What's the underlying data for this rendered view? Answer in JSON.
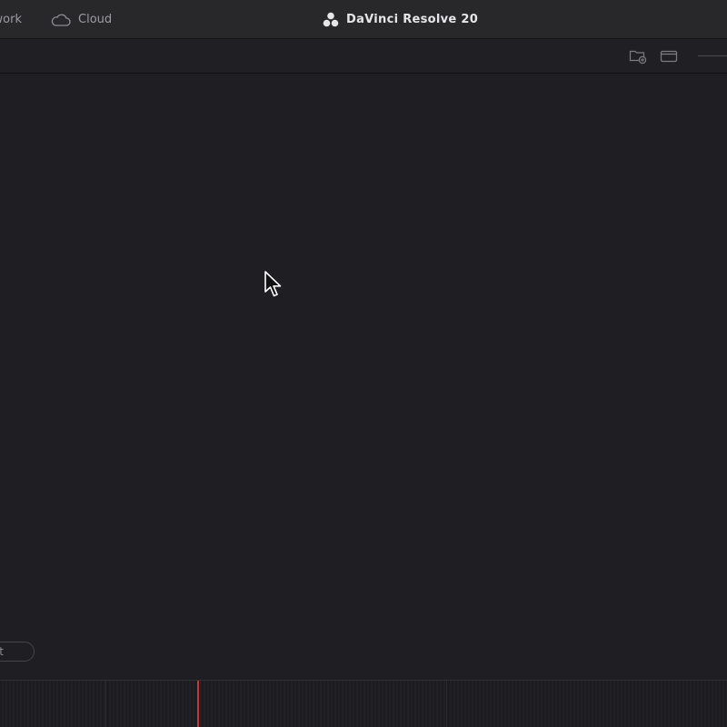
{
  "topbar": {
    "tabs": [
      {
        "label": "Network",
        "icon": "network-icon"
      },
      {
        "label": "Cloud",
        "icon": "cloud-icon"
      }
    ],
    "app_title": "DaVinci Resolve 20",
    "logo_icon": "davinci-logo-icon"
  },
  "toolbar": {
    "buttons": [
      {
        "name": "add-folder",
        "icon": "folder-add-icon"
      },
      {
        "name": "single-view",
        "icon": "window-icon"
      }
    ]
  },
  "main": {
    "pill_label": "t"
  },
  "colors": {
    "topbar_bg": "#28282b",
    "main_bg": "#1f1f23",
    "playhead": "#c8323a",
    "text_primary": "#e6e6e8",
    "text_muted": "#9c9ca2"
  }
}
